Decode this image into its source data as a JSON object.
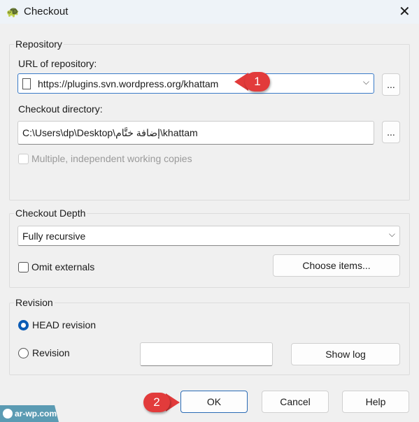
{
  "window": {
    "title": "Checkout",
    "close_icon": "close-icon",
    "app_icon": "tortoise-icon"
  },
  "repository": {
    "group_label": "Repository",
    "url_label": "URL of repository:",
    "url_value": "https://plugins.svn.wordpress.org/khattam",
    "browse_label": "...",
    "dir_label": "Checkout directory:",
    "dir_value": "C:\\Users\\dp\\Desktop\\إضافة ختَّام\\khattam",
    "dir_browse_label": "...",
    "multiple_label": "Multiple, independent working copies",
    "multiple_checked": false
  },
  "depth": {
    "group_label": "Checkout Depth",
    "selected": "Fully recursive",
    "omit_label": "Omit externals",
    "omit_checked": false,
    "choose_label": "Choose items..."
  },
  "revision": {
    "group_label": "Revision",
    "head_label": "HEAD revision",
    "head_selected": true,
    "rev_label": "Revision",
    "rev_value": "",
    "show_log_label": "Show log"
  },
  "buttons": {
    "ok": "OK",
    "cancel": "Cancel",
    "help": "Help"
  },
  "annotations": {
    "step1": "1",
    "step2": "2",
    "accent": "#e23b3b"
  },
  "watermark": {
    "text": "ar-wp.com"
  }
}
